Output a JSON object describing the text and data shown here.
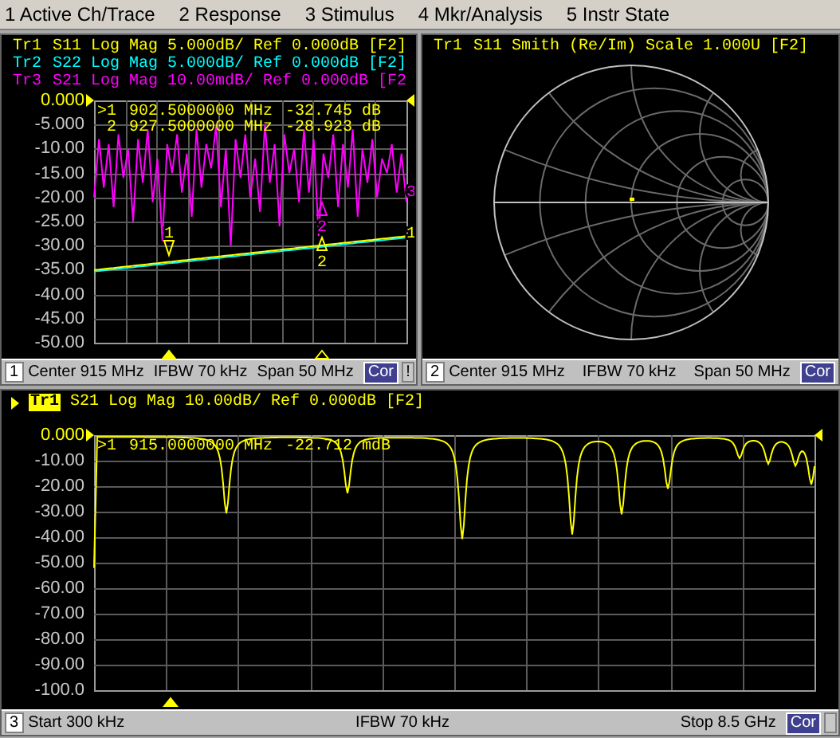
{
  "menu": [
    {
      "label": "1 Active Ch/Trace"
    },
    {
      "label": "2 Response"
    },
    {
      "label": "3 Stimulus"
    },
    {
      "label": "4 Mkr/Analysis"
    },
    {
      "label": "5 Instr State"
    }
  ],
  "channels": [
    {
      "kind": "rect",
      "traces": [
        {
          "name": "Tr1",
          "description": "S11 Log Mag 5.000dB/ Ref 0.000dB [F2]",
          "color": "#ffff00",
          "selected": false
        },
        {
          "name": "Tr2",
          "description": "S22 Log Mag 5.000dB/ Ref 0.000dB [F2]",
          "color": "#00ffff",
          "selected": false
        },
        {
          "name": "Tr3",
          "description": "S21 Log Mag 10.00mdB/ Ref 0.000dB [F2",
          "color": "#ff00ff",
          "selected": false
        }
      ],
      "chart_data": {
        "type": "line",
        "ylim": [
          -50,
          0
        ],
        "yticks": [
          {
            "value": 0,
            "label": "0.000"
          },
          {
            "value": -5,
            "label": "-5.000"
          },
          {
            "value": -10,
            "label": "-10.00"
          },
          {
            "value": -15,
            "label": "-15.00"
          },
          {
            "value": -20,
            "label": "-20.00"
          },
          {
            "value": -25,
            "label": "-25.00"
          },
          {
            "value": -30,
            "label": "-30.00"
          },
          {
            "value": -35,
            "label": "-35.00"
          },
          {
            "value": -40,
            "label": "-40.00"
          },
          {
            "value": -45,
            "label": "-45.00"
          },
          {
            "value": -50,
            "label": "-50.00"
          }
        ],
        "series": [
          {
            "color": "#ff00ff",
            "values": [
              -20,
              -8,
              -18,
              -9,
              -22,
              -7,
              -16,
              -10,
              -25,
              -8,
              -17,
              -6,
              -21,
              -12,
              -29,
              -9,
              -15,
              -7,
              -19,
              -11,
              -24,
              -6,
              -18,
              -9,
              -14,
              -5,
              -22,
              -10,
              -30,
              -8,
              -16,
              -7,
              -20,
              -12,
              -23,
              -5,
              -17,
              -9,
              -26,
              -7,
              -15,
              -10,
              -21,
              -6,
              -19,
              -8,
              -28,
              -11,
              -16,
              -7,
              -22,
              -9,
              -18,
              -6,
              -24,
              -10,
              -17,
              -8,
              -20,
              -12,
              -15,
              -9,
              -19,
              -11,
              -21
            ]
          },
          {
            "color": "#00ffff",
            "values": [
              -35.3,
              -35.19,
              -35.08,
              -34.97,
              -34.86,
              -34.75,
              -34.64,
              -34.53,
              -34.43,
              -34.32,
              -34.21,
              -34.1,
              -33.99,
              -33.88,
              -33.77,
              -33.66,
              -33.55,
              -33.44,
              -33.33,
              -33.22,
              -33.11,
              -33,
              -32.89,
              -32.78,
              -32.68,
              -32.57,
              -32.46,
              -32.35,
              -32.24,
              -32.13,
              -32.02,
              -31.91,
              -31.8,
              -31.69,
              -31.58,
              -31.47,
              -31.36,
              -31.25,
              -31.14,
              -31.03,
              -30.93,
              -30.82,
              -30.71,
              -30.6,
              -30.49,
              -30.38,
              -30.27,
              -30.16,
              -30.05,
              -29.94,
              -29.83,
              -29.72,
              -29.61,
              -29.5,
              -29.39,
              -29.28,
              -29.18,
              -29.07,
              -28.96,
              -28.85,
              -28.74,
              -28.63,
              -28.52,
              -28.41,
              -28.3
            ]
          },
          {
            "color": "#ffff00",
            "values": [
              -35,
              -34.89,
              -34.78,
              -34.67,
              -34.56,
              -34.45,
              -34.34,
              -34.23,
              -34.13,
              -34.02,
              -33.91,
              -33.8,
              -33.69,
              -33.58,
              -33.47,
              -33.36,
              -33.25,
              -33.14,
              -33.03,
              -32.92,
              -32.81,
              -32.7,
              -32.59,
              -32.48,
              -32.38,
              -32.27,
              -32.16,
              -32.05,
              -31.94,
              -31.83,
              -31.72,
              -31.61,
              -31.5,
              -31.39,
              -31.28,
              -31.17,
              -31.06,
              -30.95,
              -30.84,
              -30.73,
              -30.63,
              -30.52,
              -30.41,
              -30.3,
              -30.19,
              -30.08,
              -29.97,
              -29.86,
              -29.75,
              -29.64,
              -29.53,
              -29.42,
              -29.31,
              -29.2,
              -29.09,
              -28.98,
              -28.88,
              -28.77,
              -28.66,
              -28.55,
              -28.44,
              -28.33,
              -28.22,
              -28.11,
              -28
            ]
          }
        ],
        "grid": true
      },
      "marker_labels": [
        {
          "label": "1",
          "color": "#ffff00"
        },
        {
          "label": "2",
          "color": "#ff00ff"
        },
        {
          "label": "2",
          "color": "#ffff00"
        },
        {
          "label": "3",
          "color": "#ff00ff"
        },
        {
          "label": "1",
          "color": "#ffff00"
        }
      ],
      "readouts": [
        {
          "marker": ">1",
          "frequency": "902.5000000 MHz",
          "value": "-32.745 dB"
        },
        {
          "marker": "2",
          "frequency": "927.5000000 MHz",
          "value": "-28.923 dB"
        }
      ],
      "status": {
        "number": "1",
        "left": "Center 915 MHz",
        "middle": "IFBW 70 kHz",
        "right": "Span 50 MHz",
        "correction": "Cor",
        "indicator": true,
        "indicator_text": "!"
      }
    },
    {
      "kind": "smith",
      "traces": [
        {
          "name": "Tr1",
          "description": "S11 Smith (Re/Im) Scale 1.000U [F2]",
          "color": "#ffff00",
          "selected": false
        }
      ],
      "status": {
        "number": "2",
        "left": "Center 915 MHz",
        "middle": "IFBW 70 kHz",
        "right": "Span 50 MHz",
        "correction": "Cor",
        "indicator": false
      }
    },
    {
      "kind": "rect",
      "traces": [
        {
          "name": "Tr1",
          "description": "S21 Log Mag 10.00dB/ Ref 0.000dB [F2]",
          "color": "#ffff00",
          "selected": true
        }
      ],
      "scale_labels": [
        "0.000",
        "-10.00",
        "-20.00",
        "-30.00",
        "-40.00",
        "-50.00",
        "-60.00",
        "-70.00",
        "-80.00",
        "-90.00",
        "-100.0"
      ],
      "readouts": [
        {
          "marker": ">1",
          "frequency": "915.0000000 MHz",
          "value": "-22.712 mdB"
        }
      ],
      "status": {
        "number": "3",
        "left": "Start 300 kHz",
        "middle": "IFBW 70 kHz",
        "right": "Stop 8.5 GHz",
        "correction": "Cor",
        "indicator": true
      }
    }
  ]
}
